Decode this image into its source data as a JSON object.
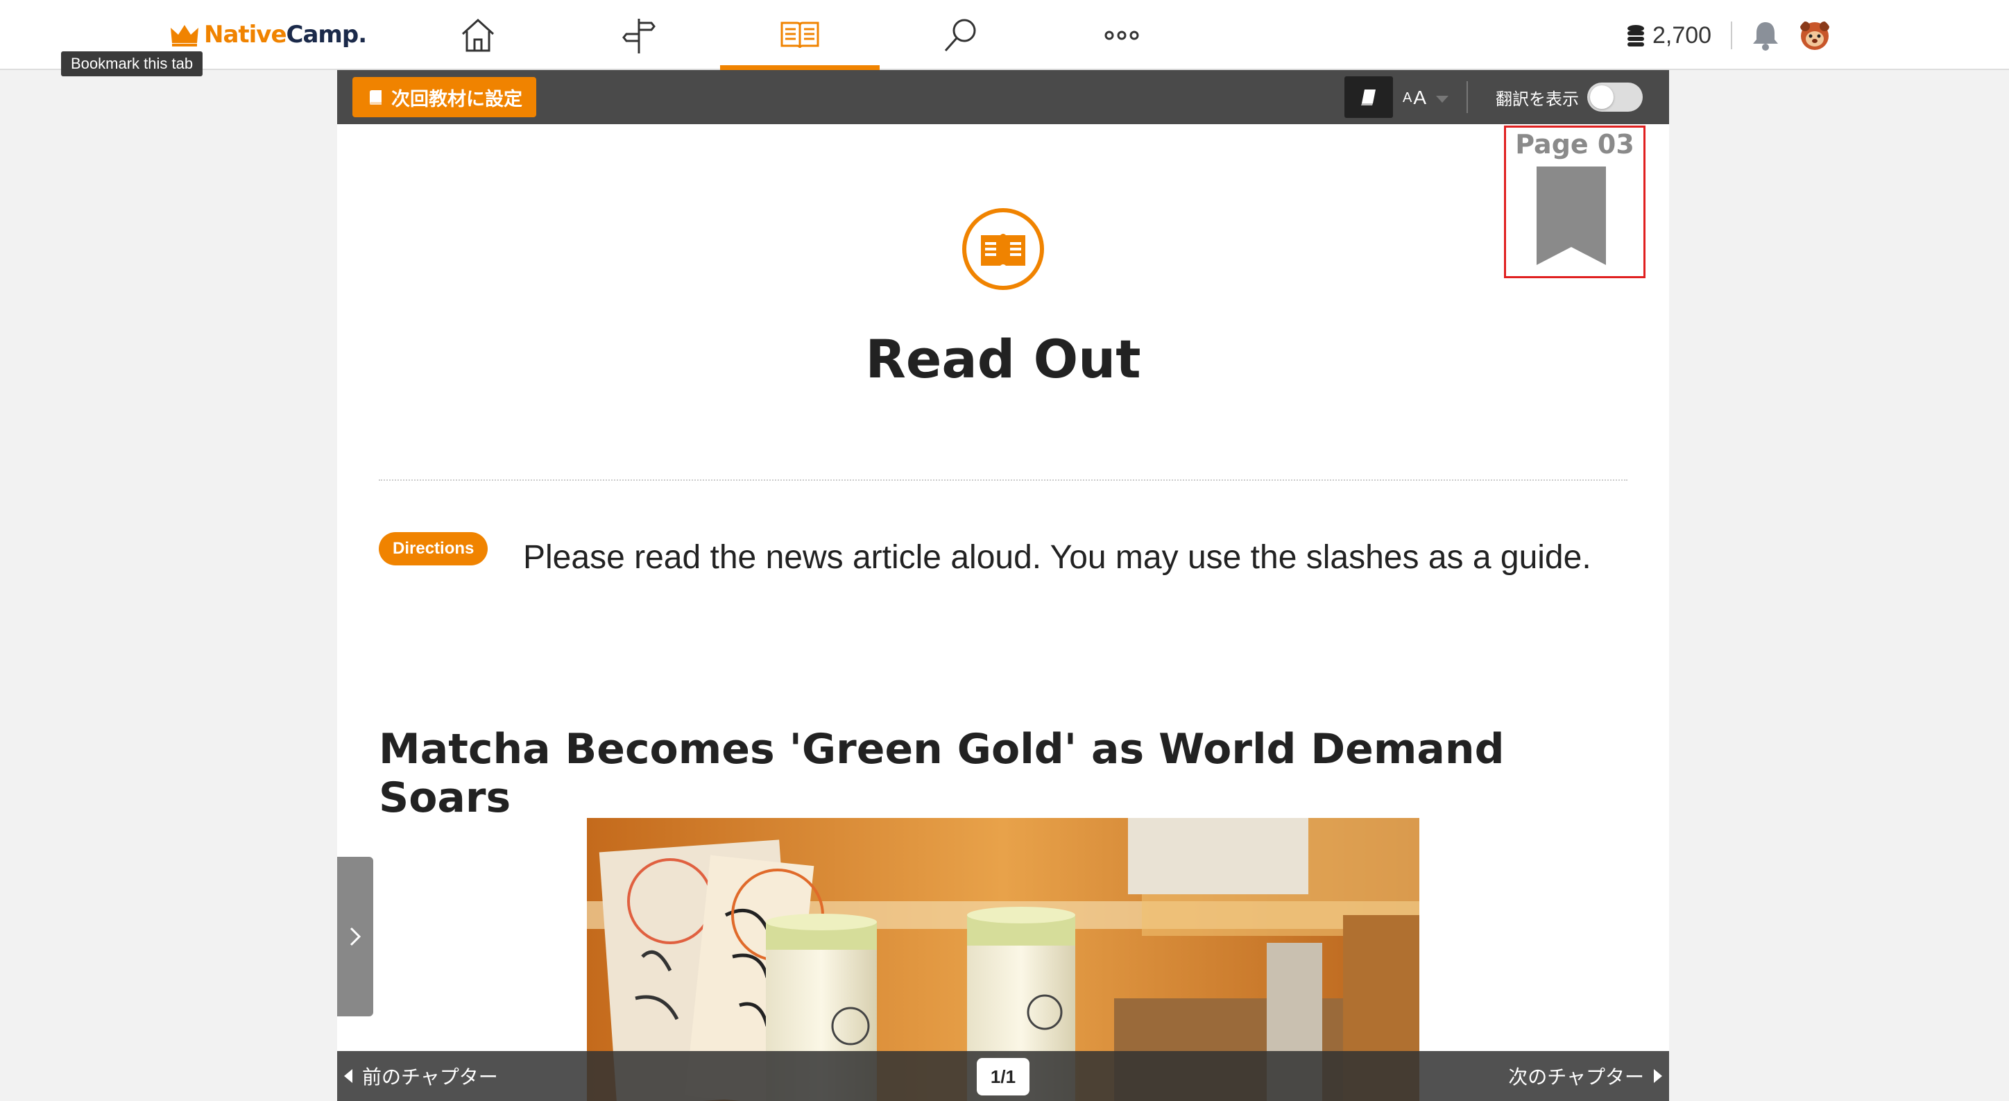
{
  "app": {
    "brand_native": "Native",
    "brand_camp": "Camp.",
    "tooltip": "Bookmark this tab",
    "coins": "2,700"
  },
  "nav": {
    "items": [
      {
        "name": "home",
        "icon": "home-icon"
      },
      {
        "name": "courses",
        "icon": "signpost-icon"
      },
      {
        "name": "textbook",
        "icon": "open-book-icon",
        "active": true
      },
      {
        "name": "search",
        "icon": "search-icon"
      },
      {
        "name": "more",
        "icon": "more-dots-icon"
      }
    ]
  },
  "toolbar": {
    "set_next_label": "次回教材に設定",
    "font_small": "A",
    "font_big": "A",
    "translate_label": "翻訳を表示",
    "translate_on": false
  },
  "page": {
    "marker_label": "Page 03",
    "heading": "Read Out",
    "directions_badge": "Directions",
    "directions_text": "Please read the news article aloud. You may use the slashes as a guide.",
    "article_title": "Matcha Becomes 'Green Gold' as World Demand Soars"
  },
  "footer": {
    "prev_label": "前のチャプター",
    "next_label": "次のチャプター",
    "page_count": "1/1"
  },
  "colors": {
    "accent": "#f08300",
    "toolbar_bg": "#4a4a4a",
    "navy": "#1b2a4a",
    "highlight_border": "#e02020"
  }
}
